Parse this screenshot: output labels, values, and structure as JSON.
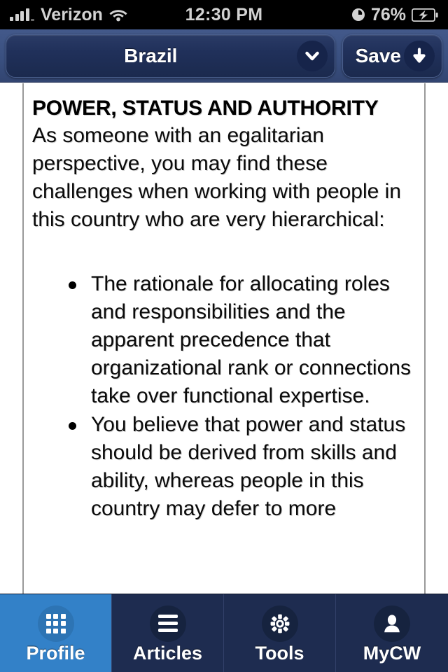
{
  "status_bar": {
    "signal_icon": "signal-bars-icon",
    "carrier": "Verizon",
    "wifi_icon": "wifi-icon",
    "time": "12:30 PM",
    "alarm_icon": "clock-icon",
    "battery_percent": "76%",
    "battery_icon": "battery-charging-icon"
  },
  "nav_bar": {
    "country": "Brazil",
    "country_dropdown_icon": "chevron-down-icon",
    "save_label": "Save",
    "save_icon": "arrow-down-icon"
  },
  "content": {
    "heading": "POWER, STATUS AND AUTHORITY",
    "intro": "As someone with an egalitarian perspective, you may find these challenges when working with people in this country who are very hierarchical:",
    "bullets": [
      "The rationale for allocating roles and responsibilities and the apparent precedence that organizational rank or connections take over functional expertise.",
      "You believe that power and status should be derived from skills and ability, whereas people in this country may defer to more"
    ]
  },
  "tab_bar": {
    "active_index": 0,
    "tabs": [
      {
        "label": "Profile",
        "icon": "grid-icon"
      },
      {
        "label": "Articles",
        "icon": "hamburger-icon"
      },
      {
        "label": "Tools",
        "icon": "gear-icon"
      },
      {
        "label": "MyCW",
        "icon": "person-icon"
      }
    ]
  },
  "colors": {
    "nav_bar": "#3a5080",
    "nav_button": "#20305a",
    "tab_active": "#3381c8",
    "tab_inactive": "#1e2c50",
    "status_bar": "#000000"
  }
}
